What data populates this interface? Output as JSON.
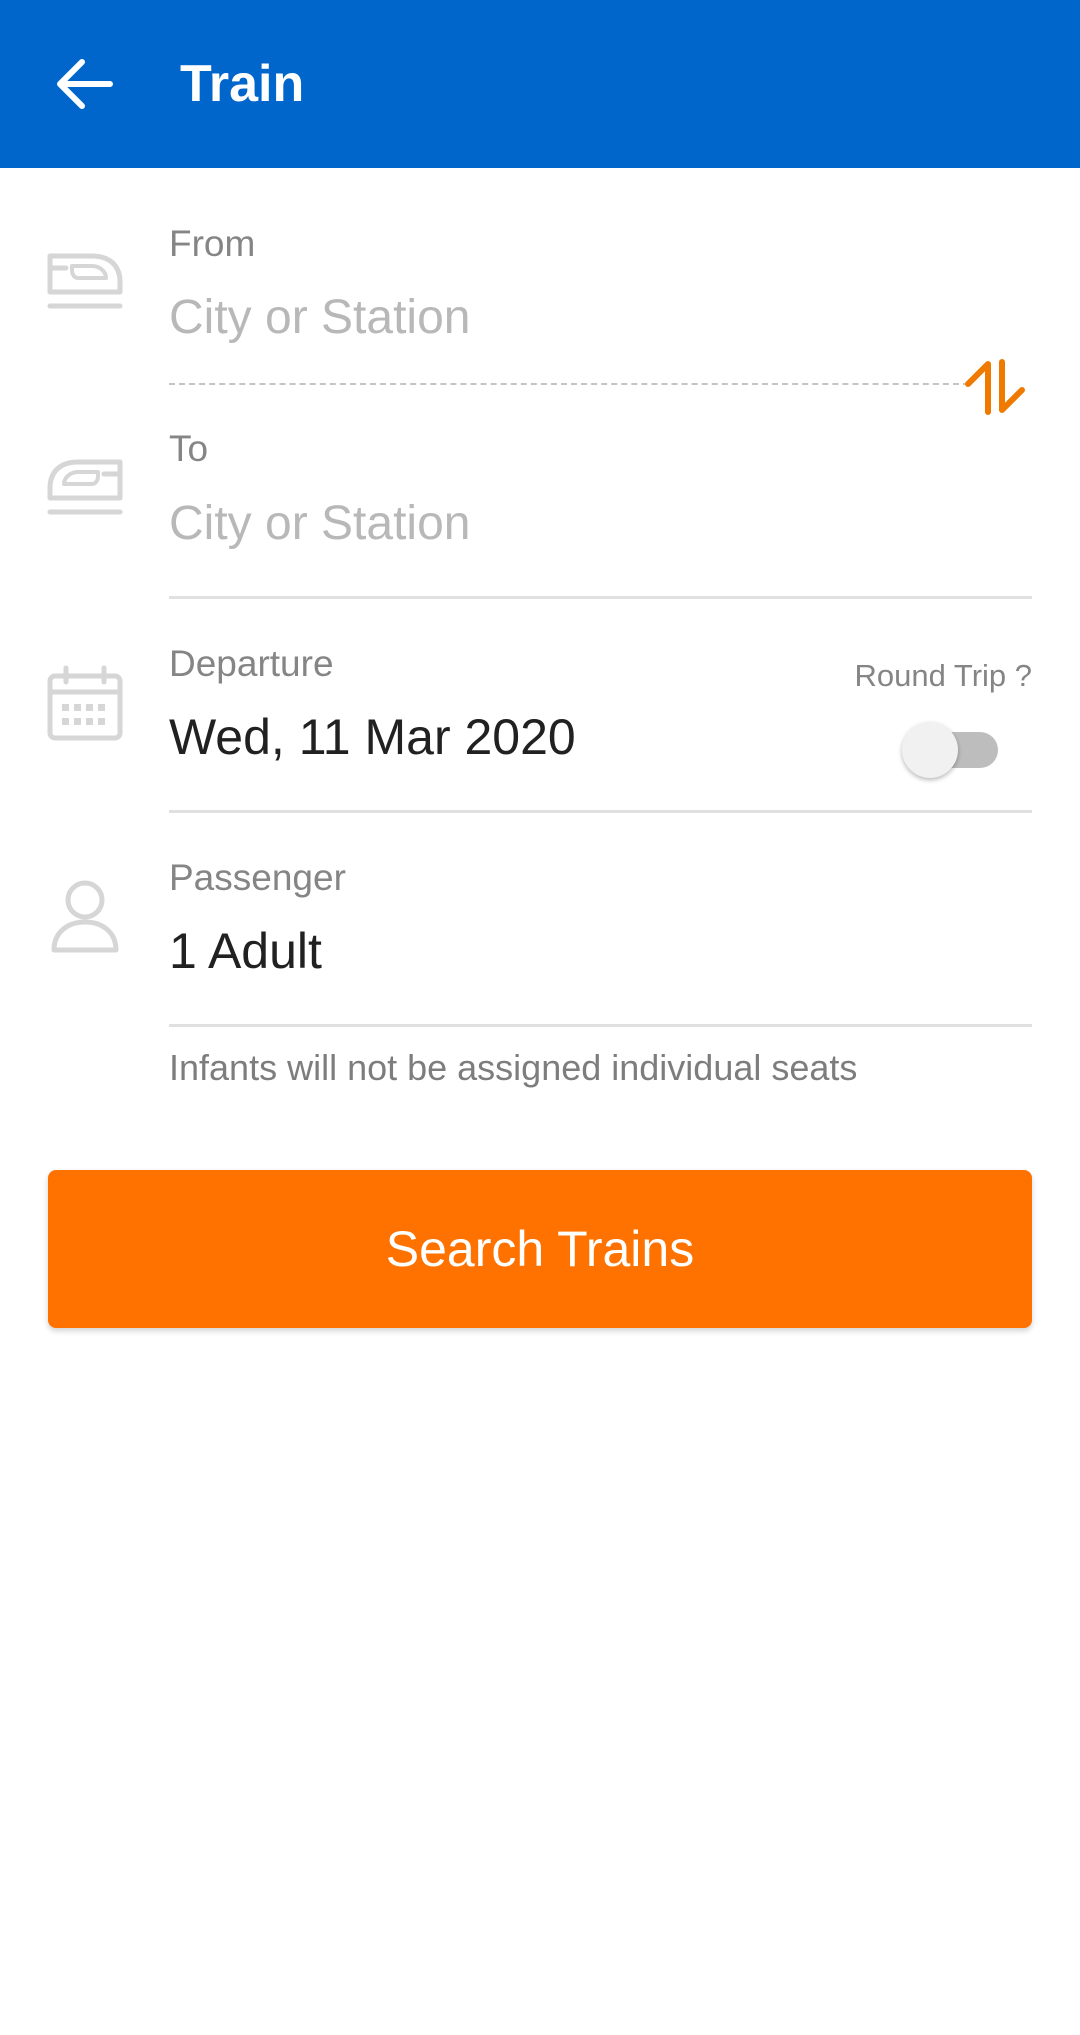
{
  "app_bar": {
    "title": "Train",
    "back_icon": "arrow-left-icon",
    "background": "#0066CC"
  },
  "from": {
    "icon": "train-icon",
    "label": "From",
    "placeholder": "City or Station"
  },
  "swap": {
    "icon": "swap-vertical-icon",
    "color": "#F07A00"
  },
  "to": {
    "icon": "train-icon",
    "label": "To",
    "placeholder": "City or Station"
  },
  "departure": {
    "icon": "calendar-icon",
    "label": "Departure",
    "value": "Wed, 11 Mar 2020",
    "round_trip_label": "Round Trip ?",
    "round_trip_enabled": false
  },
  "passenger": {
    "icon": "person-icon",
    "label": "Passenger",
    "value": "1 Adult",
    "hint": "Infants will not be assigned individual seats"
  },
  "search_button": {
    "label": "Search Trains",
    "color": "#FF7200"
  }
}
